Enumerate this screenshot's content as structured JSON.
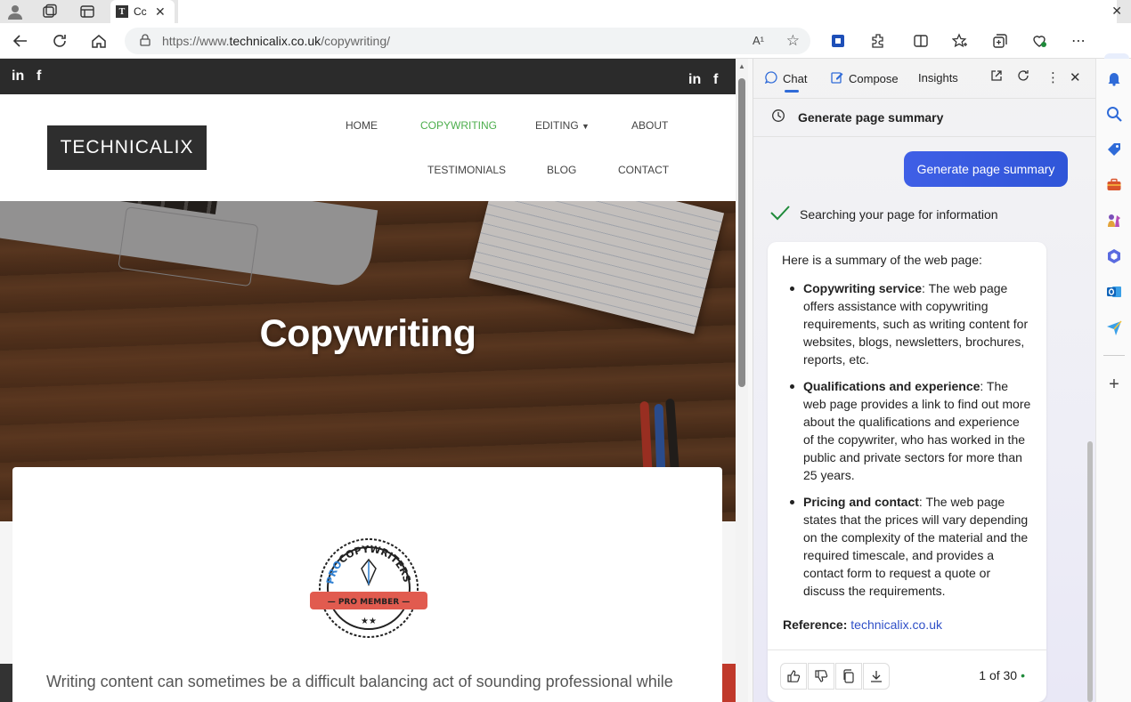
{
  "browser": {
    "tab_title": "Cc",
    "url_prefix": "https://www.",
    "url_domain": "technicalix.co.uk",
    "url_path": "/copywriting/",
    "read_aloud": "A¹"
  },
  "site": {
    "social_left": [
      "in",
      "f"
    ],
    "social_right": [
      "in",
      "f"
    ],
    "logo": "TECHNICALIX",
    "nav": [
      {
        "label": "HOME",
        "active": false
      },
      {
        "label": "COPYWRITING",
        "active": true
      },
      {
        "label": "EDITING",
        "active": false
      },
      {
        "label": "ABOUT",
        "active": false
      },
      {
        "label": "TESTIMONIALS",
        "active": false
      },
      {
        "label": "BLOG",
        "active": false
      },
      {
        "label": "CONTACT",
        "active": false
      }
    ],
    "hero_title": "Copywriting",
    "badge": {
      "top": "PROCOPYWRITERS",
      "band": "PRO MEMBER",
      "stars": "★★"
    },
    "lead": "Writing content can sometimes be a difficult balancing act of sounding professional while"
  },
  "copilot": {
    "tabs": [
      "Chat",
      "Compose",
      "Insights"
    ],
    "header": "Generate page summary",
    "prompt_button": "Generate page summary",
    "status": "Searching your page for information",
    "intro": "Here is a summary of the web page:",
    "bullets": [
      {
        "title": "Copywriting service",
        "text": ": The web page offers assistance with copywriting requirements, such as writing content for websites, blogs, newsletters, brochures, reports, etc."
      },
      {
        "title": "Qualifications and experience",
        "text": ": The web page provides a link to find out more about the qualifications and experience of the copywriter, who has worked in the public and private sectors for more than 25 years."
      },
      {
        "title": "Pricing and contact",
        "text": ": The web page states that the prices will vary depending on the complexity of the material and the required timescale, and provides a contact form to request a quote or discuss the requirements."
      }
    ],
    "reference_label": "Reference:",
    "reference_link": "technicalix.co.uk",
    "counter": "1 of 30",
    "counter_dot": "•"
  },
  "colors": {
    "accent_nav": "#4cae4c",
    "copilot_button": "#3f5fe6",
    "link": "#2f4fc7"
  }
}
